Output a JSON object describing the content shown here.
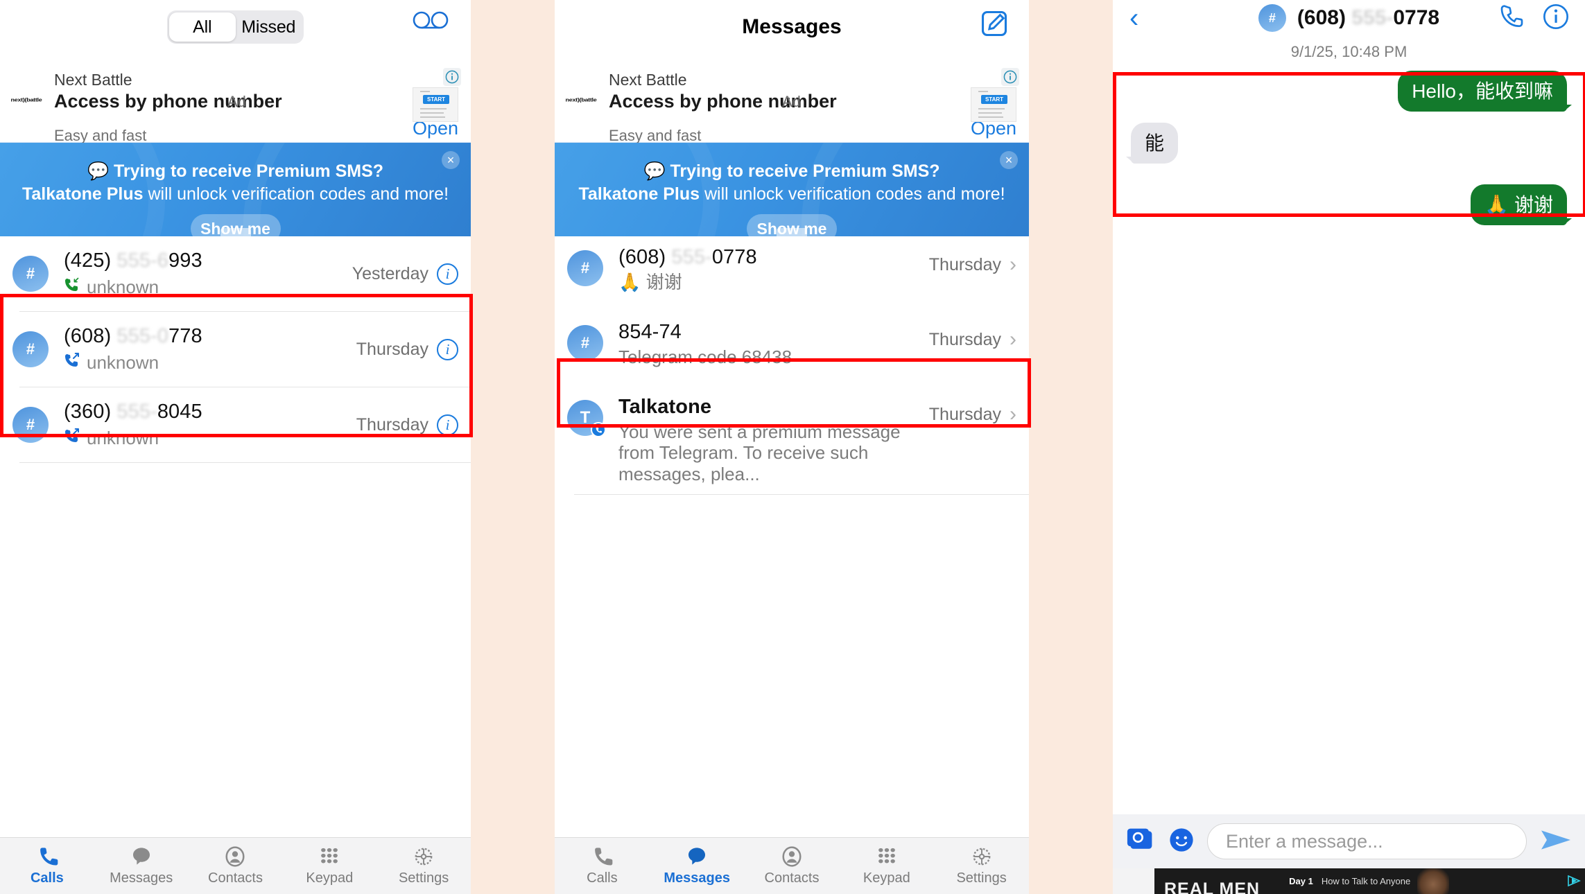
{
  "app": {
    "name": "Talkatone"
  },
  "ad": {
    "brand": "Next Battle",
    "headline": "Access by phone number",
    "tag": "Ad",
    "sub": "Easy and fast",
    "open_label": "Open",
    "logo_text": "next)(battle",
    "thumb_cta": "START",
    "info_icon": "info-icon"
  },
  "promo": {
    "line1": "💬 Trying to receive Premium SMS?",
    "line2_bold": "Talkatone Plus",
    "line2_rest": " will unlock verification codes and more!",
    "button": "Show me",
    "close": "×"
  },
  "calls": {
    "segmented": {
      "options": [
        "All",
        "Missed"
      ],
      "selected": "All"
    },
    "voicemail_icon": "voicemail-icon",
    "rows": [
      {
        "avatar": "#",
        "number_prefix": "(425) ",
        "number_blur": "555-6",
        "number_suffix": "993",
        "direction": "incoming",
        "sub": "unknown",
        "time": "Yesterday"
      },
      {
        "avatar": "#",
        "number_prefix": "(608) ",
        "number_blur": "555-0",
        "number_suffix": "778",
        "direction": "outgoing",
        "sub": "unknown",
        "time": "Thursday"
      },
      {
        "avatar": "#",
        "number_prefix": "(360) ",
        "number_blur": "555-",
        "number_suffix": "8045",
        "direction": "outgoing",
        "sub": "unknown",
        "time": "Thursday"
      }
    ]
  },
  "messages": {
    "title": "Messages",
    "compose_icon": "compose-icon",
    "rows": [
      {
        "avatar": "#",
        "avatar_type": "hash",
        "title_prefix": "(608) ",
        "title_blur": "555-",
        "title_suffix": "0778",
        "preview": "🙏 谢谢",
        "time": "Thursday"
      },
      {
        "avatar": "#",
        "avatar_type": "hash",
        "title_prefix": "854-74",
        "title_blur": "",
        "title_suffix": "",
        "preview": "Telegram code 68438",
        "time": "Thursday"
      },
      {
        "avatar": "T",
        "avatar_type": "letter",
        "verified": true,
        "title_prefix": "Talkatone",
        "title_blur": "",
        "title_suffix": "",
        "preview": "You were sent a premium message from Telegram. To receive such messages, plea...",
        "time": "Thursday"
      }
    ]
  },
  "thread": {
    "back_icon": "back-chevron-icon",
    "avatar": "#",
    "name_prefix": "(608) ",
    "name_blur": "555-",
    "name_suffix": "0778",
    "call_icon": "phone-icon",
    "info_icon": "info-icon",
    "date": "9/1/25, 10:48 PM",
    "bubbles": [
      {
        "side": "out",
        "text": "Hello，能收到嘛"
      },
      {
        "side": "in",
        "text": "能"
      },
      {
        "side": "out",
        "text": "🙏 谢谢"
      }
    ],
    "composer": {
      "camera_icon": "camera-icon",
      "emoji_icon": "emoji-icon",
      "placeholder": "Enter a message...",
      "send_icon": "send-icon"
    },
    "bottom_ad": {
      "big": "REAL MEN",
      "day": "Day 1",
      "text": "How to Talk to Anyone",
      "admark": "admob-icon"
    }
  },
  "tabbar": {
    "items": [
      {
        "label": "Calls",
        "icon": "phone-icon"
      },
      {
        "label": "Messages",
        "icon": "chat-bubble-icon"
      },
      {
        "label": "Contacts",
        "icon": "person-circle-icon"
      },
      {
        "label": "Keypad",
        "icon": "dialpad-icon"
      },
      {
        "label": "Settings",
        "icon": "gear-icon"
      }
    ],
    "active_calls": "Calls",
    "active_messages": "Messages"
  },
  "colors": {
    "accent_blue": "#1a7bde",
    "bubble_green": "#137a2c",
    "bubble_gray": "#e5e5ea",
    "highlight_red": "#ff0000",
    "page_bg": "#fbeade"
  }
}
